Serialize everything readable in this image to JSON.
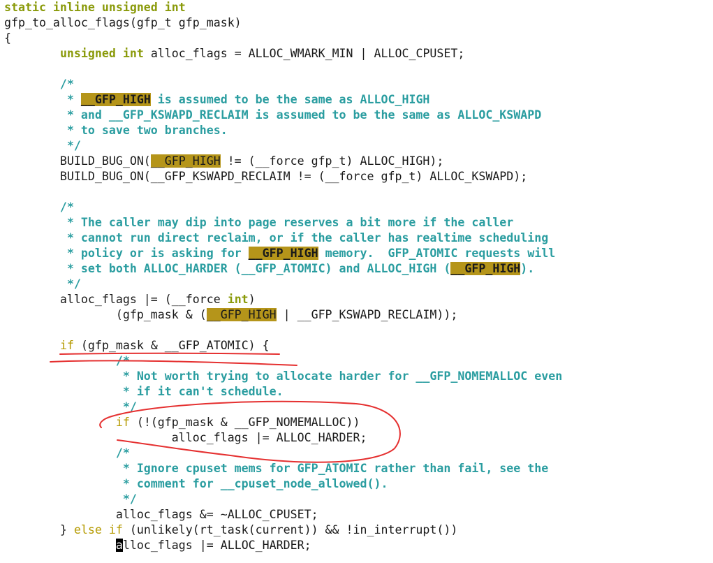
{
  "editor": {
    "colors": {
      "type_keyword": "#8a9a0a",
      "control_keyword": "#b59a00",
      "comment": "#2a9da0",
      "search_highlight": "#b5951a",
      "annotation_ink": "#e53030",
      "cursor": "#000000"
    },
    "lines": [
      [
        {
          "t": "static inline unsigned int",
          "c": "type"
        }
      ],
      [
        {
          "t": "gfp_to_alloc_flags(gfp_t gfp_mask)",
          "c": "plain"
        }
      ],
      [
        {
          "t": "{",
          "c": "plain"
        }
      ],
      [
        {
          "t": "        ",
          "c": "plain"
        },
        {
          "t": "unsigned int",
          "c": "type"
        },
        {
          "t": " alloc_flags = ALLOC_WMARK_MIN | ALLOC_CPUSET;",
          "c": "plain"
        }
      ],
      [
        {
          "t": "",
          "c": "plain"
        }
      ],
      [
        {
          "t": "        /*",
          "c": "comment"
        }
      ],
      [
        {
          "t": "         * ",
          "c": "comment"
        },
        {
          "t": "__GFP_HIGH",
          "c": "hl-comment"
        },
        {
          "t": " is assumed to be the same as ALLOC_HIGH",
          "c": "comment"
        }
      ],
      [
        {
          "t": "         * and __GFP_KSWAPD_RECLAIM is assumed to be the same as ALLOC_KSWAPD",
          "c": "comment"
        }
      ],
      [
        {
          "t": "         * to save two branches.",
          "c": "comment"
        }
      ],
      [
        {
          "t": "         */",
          "c": "comment"
        }
      ],
      [
        {
          "t": "        BUILD_BUG_ON(",
          "c": "plain"
        },
        {
          "t": "__GFP_HIGH",
          "c": "hl"
        },
        {
          "t": " != (__force gfp_t) ALLOC_HIGH);",
          "c": "plain"
        }
      ],
      [
        {
          "t": "        BUILD_BUG_ON(__GFP_KSWAPD_RECLAIM != (__force gfp_t) ALLOC_KSWAPD);",
          "c": "plain"
        }
      ],
      [
        {
          "t": "",
          "c": "plain"
        }
      ],
      [
        {
          "t": "        /*",
          "c": "comment"
        }
      ],
      [
        {
          "t": "         * The caller may dip into page reserves a bit more if the caller",
          "c": "comment"
        }
      ],
      [
        {
          "t": "         * cannot run direct reclaim, or if the caller has realtime scheduling",
          "c": "comment"
        }
      ],
      [
        {
          "t": "         * policy or is asking for ",
          "c": "comment"
        },
        {
          "t": "__GFP_HIGH",
          "c": "hl-comment"
        },
        {
          "t": " memory.  GFP_ATOMIC requests will",
          "c": "comment"
        }
      ],
      [
        {
          "t": "         * set both ALLOC_HARDER (__GFP_ATOMIC) and ALLOC_HIGH (",
          "c": "comment"
        },
        {
          "t": "__GFP_HIGH",
          "c": "hl-comment"
        },
        {
          "t": ").",
          "c": "comment"
        }
      ],
      [
        {
          "t": "         */",
          "c": "comment"
        }
      ],
      [
        {
          "t": "        alloc_flags |= (__force ",
          "c": "plain"
        },
        {
          "t": "int",
          "c": "type"
        },
        {
          "t": ")",
          "c": "plain"
        }
      ],
      [
        {
          "t": "                (gfp_mask & (",
          "c": "plain"
        },
        {
          "t": "__GFP_HIGH",
          "c": "hl"
        },
        {
          "t": " | __GFP_KSWAPD_RECLAIM));",
          "c": "plain"
        }
      ],
      [
        {
          "t": "",
          "c": "plain"
        }
      ],
      [
        {
          "t": "        ",
          "c": "plain"
        },
        {
          "t": "if",
          "c": "kw"
        },
        {
          "t": " (gfp_mask & __GFP_ATOMIC) {",
          "c": "plain"
        }
      ],
      [
        {
          "t": "                /*",
          "c": "comment"
        }
      ],
      [
        {
          "t": "                 * Not worth trying to allocate harder for __GFP_NOMEMALLOC even",
          "c": "comment"
        }
      ],
      [
        {
          "t": "                 * if it can't schedule.",
          "c": "comment"
        }
      ],
      [
        {
          "t": "                 */",
          "c": "comment"
        }
      ],
      [
        {
          "t": "                ",
          "c": "plain"
        },
        {
          "t": "if",
          "c": "kw"
        },
        {
          "t": " (!(gfp_mask & __GFP_NOMEMALLOC))",
          "c": "plain"
        }
      ],
      [
        {
          "t": "                        alloc_flags |= ALLOC_HARDER;",
          "c": "plain"
        }
      ],
      [
        {
          "t": "                /*",
          "c": "comment"
        }
      ],
      [
        {
          "t": "                 * Ignore cpuset mems for GFP_ATOMIC rather than fail, see the",
          "c": "comment"
        }
      ],
      [
        {
          "t": "                 * comment for __cpuset_node_allowed().",
          "c": "comment"
        }
      ],
      [
        {
          "t": "                 */",
          "c": "comment"
        }
      ],
      [
        {
          "t": "                alloc_flags &= ~ALLOC_CPUSET;",
          "c": "plain"
        }
      ],
      [
        {
          "t": "        } ",
          "c": "plain"
        },
        {
          "t": "else if",
          "c": "kw"
        },
        {
          "t": " (unlikely(rt_task(current)) && !in_interrupt())",
          "c": "plain"
        }
      ],
      [
        {
          "t": "                ",
          "c": "plain"
        },
        {
          "t": "a",
          "c": "cursor"
        },
        {
          "t": "lloc_flags |= ALLOC_HARDER;",
          "c": "plain"
        }
      ]
    ]
  }
}
